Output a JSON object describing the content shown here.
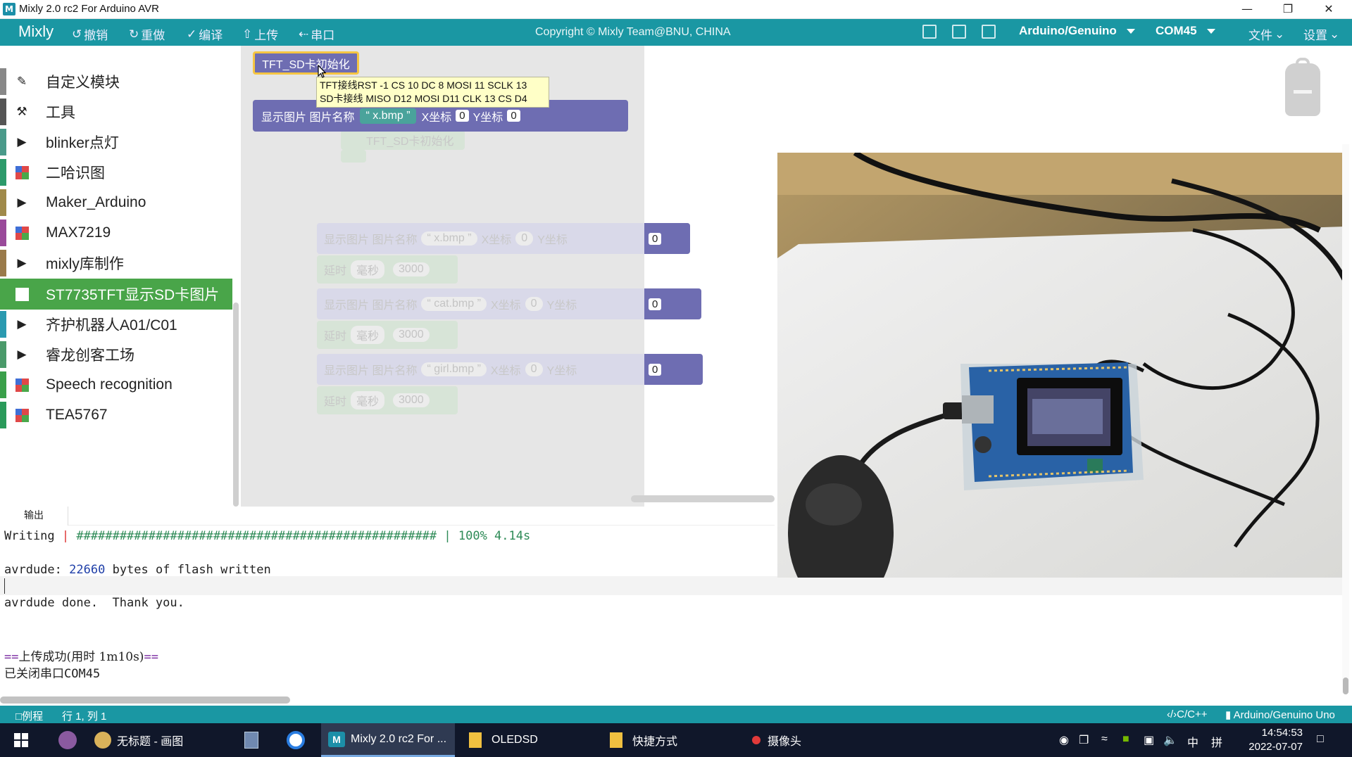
{
  "window": {
    "title": "Mixly 2.0 rc2 For Arduino AVR"
  },
  "menu": {
    "brand": "Mixly",
    "undo": "撤销",
    "redo": "重做",
    "compile": "编译",
    "upload": "上传",
    "serial": "串口",
    "copyright": "Copyright © Mixly Team@BNU, CHINA",
    "board": "Arduino/Genuino",
    "port": "COM45",
    "file": "文件",
    "settings": "设置"
  },
  "sidebar": {
    "categories": [
      {
        "label": "自定义模块",
        "icon": "pen-icon",
        "color": "#888888",
        "selected": false
      },
      {
        "label": "工具",
        "icon": "tools-icon",
        "color": "#555555",
        "selected": false
      },
      {
        "label": "blinker点灯",
        "icon": "expand-arrow-icon",
        "color": "#4a9a8a",
        "selected": false
      },
      {
        "label": "二哈识图",
        "icon": "puzzle-icon",
        "color": "#2c9a6a",
        "selected": false
      },
      {
        "label": "Maker_Arduino",
        "icon": "expand-arrow-icon",
        "color": "#a08a4a",
        "selected": false
      },
      {
        "label": "MAX7219",
        "icon": "puzzle-icon",
        "color": "#9a4a9a",
        "selected": false
      },
      {
        "label": "mixly库制作",
        "icon": "expand-arrow-icon",
        "color": "#9a7a4a",
        "selected": false
      },
      {
        "label": "ST7735TFT显示SD卡图片",
        "icon": "puzzle-icon",
        "color": "#49a549",
        "selected": true
      },
      {
        "label": "齐护机器人A01/C01",
        "icon": "expand-arrow-icon",
        "color": "#2a9ab0",
        "selected": false
      },
      {
        "label": "睿龙创客工场",
        "icon": "expand-arrow-icon",
        "color": "#4a9a6a",
        "selected": false
      },
      {
        "label": "Speech recognition",
        "icon": "puzzle-icon",
        "color": "#3aa04a",
        "selected": false
      },
      {
        "label": "TEA5767",
        "icon": "puzzle-icon",
        "color": "#2a9a5a",
        "selected": false
      }
    ]
  },
  "workspace": {
    "init_block": "TFT_SD卡初始化",
    "show_block": {
      "prefix": "显示图片 图片名称",
      "filename": "x.bmp",
      "x_label": "X坐标",
      "x": "0",
      "y_label": "Y坐标",
      "y": "0"
    },
    "ghost_init": "TFT_SD卡初始化",
    "ghost_rows": [
      {
        "prefix": "显示图片 图片名称",
        "filename": "x.bmp",
        "x_label": "X坐标",
        "x": "0",
        "y_label": "Y坐标",
        "y": "0",
        "delay_label": "延时",
        "delay_unit": "毫秒",
        "delay": "3000"
      },
      {
        "prefix": "显示图片 图片名称",
        "filename": "cat.bmp",
        "x_label": "X坐标",
        "x": "0",
        "y_label": "Y坐标",
        "y": "0",
        "delay_label": "延时",
        "delay_unit": "毫秒",
        "delay": "3000"
      },
      {
        "prefix": "显示图片 图片名称",
        "filename": "girl.bmp",
        "x_label": "X坐标",
        "x": "0",
        "y_label": "Y坐标",
        "y": "0",
        "delay_label": "延时",
        "delay_unit": "毫秒",
        "delay": "3000"
      }
    ],
    "tooltip_line1": "TFT接线RST -1 CS 10 DC 8 MOSI 11 SCLK 13",
    "tooltip_line2": "SD卡接线 MISO D12 MOSI D11 CLK 13 CS D4"
  },
  "output": {
    "tab": "输出",
    "writing_label": "Writing",
    "writing_sep": "|",
    "progress_bar": "##################################################",
    "progress_tail": "| 100% 4.14s",
    "avrdude_prefix": "avrdude:",
    "bytes": "22660",
    "bytes_suffix": "bytes of flash written",
    "done": "avrdude done.  Thank you.",
    "success_marker_l": "==",
    "success_text": "上传成功(用时 1m10s)",
    "success_marker_r": "==",
    "closed": "已关闭串口COM45"
  },
  "statusbar": {
    "examples": "例程",
    "position": "行 1, 列 1",
    "language": "C/C++",
    "board": "Arduino/Genuino Uno"
  },
  "taskbar": {
    "paint": "无标题 - 画图",
    "mixly": "Mixly 2.0 rc2 For ...",
    "oledsd": "OLEDSD",
    "shortcut": "快捷方式",
    "camera": "摄像头",
    "ime": "中",
    "layout": "拼",
    "time": "14:54:53",
    "date": "2022-07-07"
  },
  "colors": {
    "accent": "#1a97a3",
    "selected_category": "#49a549",
    "tft_block": "#6e6db2",
    "string_block": "#4aa39b",
    "progress": "#2e8b57"
  }
}
